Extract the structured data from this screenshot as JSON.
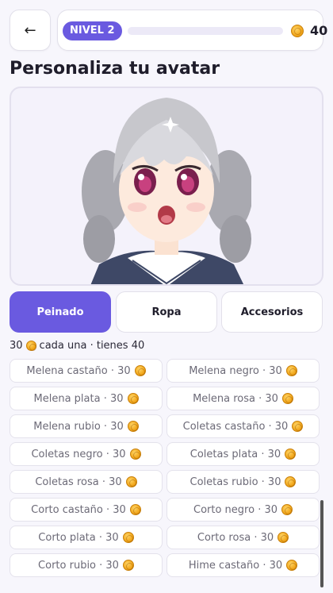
{
  "header": {
    "back_icon": "←",
    "level_label": "NIVEL 2",
    "level_progress_fraction": 0,
    "coin_icon": "coin-icon",
    "coins": "40"
  },
  "page_title": "Personaliza tu avatar",
  "tabs": [
    {
      "label": "Peinado",
      "active": true
    },
    {
      "label": "Ropa",
      "active": false
    },
    {
      "label": "Accesorios",
      "active": false
    }
  ],
  "info": {
    "price": "30",
    "suffix": "cada una · tienes 40"
  },
  "items": [
    {
      "label": "Melena castaño · 30"
    },
    {
      "label": "Melena negro · 30"
    },
    {
      "label": "Melena plata · 30"
    },
    {
      "label": "Melena rosa · 30"
    },
    {
      "label": "Melena rubio · 30"
    },
    {
      "label": "Coletas castaño · 30"
    },
    {
      "label": "Coletas negro · 30"
    },
    {
      "label": "Coletas plata · 30"
    },
    {
      "label": "Coletas rosa · 30"
    },
    {
      "label": "Coletas rubio · 30"
    },
    {
      "label": "Corto castaño · 30"
    },
    {
      "label": "Corto negro · 30"
    },
    {
      "label": "Corto plata · 30"
    },
    {
      "label": "Corto rosa · 30"
    },
    {
      "label": "Corto rubio · 30"
    },
    {
      "label": "Hime castaño · 30"
    }
  ],
  "colors": {
    "accent": "#6a5ae0",
    "background": "#f7f6fc"
  }
}
